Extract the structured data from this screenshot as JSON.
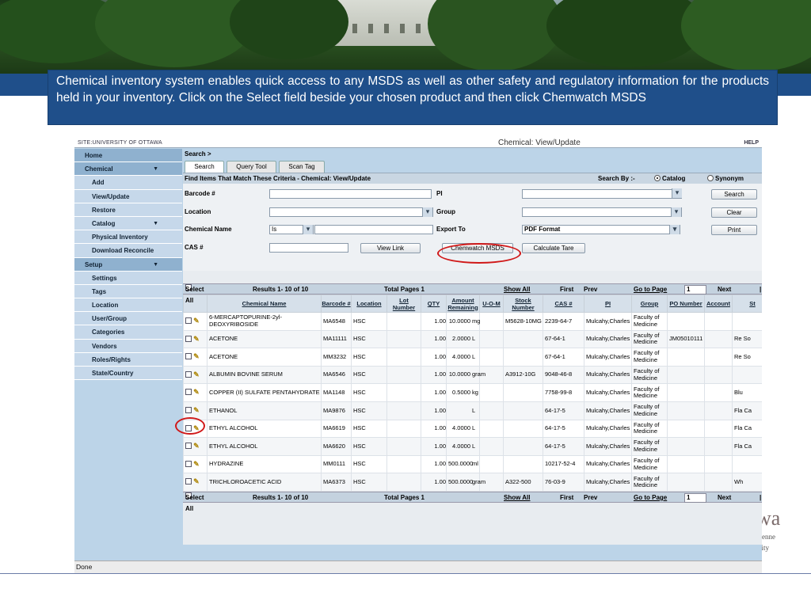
{
  "caption": "Chemical inventory system enables quick access to any MSDS as well as other safety and regulatory information for the products held in your inventory. Click on the Select field beside your chosen product and then click Chemwatch MSDS",
  "logo": {
    "text": "wa",
    "line1": "dienne",
    "line2": "rsity"
  },
  "app": {
    "site": "SITE:UNIVERSITY OF OTTAWA",
    "title": "Chemical: View/Update",
    "help": "HELP",
    "status": "Done"
  },
  "sidebar": {
    "items": [
      {
        "label": "Home",
        "level": 0
      },
      {
        "label": "Chemical",
        "level": 0,
        "arrow": "▼"
      },
      {
        "label": "Add",
        "level": 1
      },
      {
        "label": "View/Update",
        "level": 1
      },
      {
        "label": "Restore",
        "level": 1
      },
      {
        "label": "Catalog",
        "level": 1,
        "arrow": "▼"
      },
      {
        "label": "Physical Inventory",
        "level": 1
      },
      {
        "label": "Download Reconcile",
        "level": 1
      },
      {
        "label": "Setup",
        "level": 0,
        "arrow": "▼"
      },
      {
        "label": "Settings",
        "level": 1
      },
      {
        "label": "Tags",
        "level": 1
      },
      {
        "label": "Location",
        "level": 1
      },
      {
        "label": "User/Group",
        "level": 1
      },
      {
        "label": "Categories",
        "level": 1
      },
      {
        "label": "Vendors",
        "level": 1
      },
      {
        "label": "Roles/Rights",
        "level": 1
      },
      {
        "label": "State/Country",
        "level": 1
      }
    ]
  },
  "crumb": "Search >",
  "tabs": [
    "Search",
    "Query Tool",
    "Scan Tag"
  ],
  "find": {
    "title": "Find Items That Match These Criteria - Chemical: View/Update",
    "search_by": "Search By :-",
    "opt_catalog": "Catalog",
    "opt_synonym": "Synonym"
  },
  "form": {
    "barcode": "Barcode #",
    "pi": "PI",
    "location": "Location",
    "group": "Group",
    "chemical_name": "Chemical Name",
    "is": "Is",
    "export_to": "Export To",
    "export_value": "PDF Format",
    "cas": "CAS #",
    "search": "Search",
    "clear": "Clear",
    "print": "Print",
    "view_link": "View Link",
    "chemwatch": "Chemwatch MSDS",
    "calc_tare": "Calculate Tare"
  },
  "pager": {
    "select_all": "Select All",
    "results": "Results 1- 10 of 10",
    "total_pages": "Total Pages 1",
    "show_all": "Show All",
    "first": "First",
    "prev": "Prev",
    "goto": "Go to Page",
    "page": "1",
    "next": "Next"
  },
  "columns": [
    "",
    "Chemical Name",
    "Barcode #",
    "Location",
    "Lot Number",
    "QTY",
    "Amount Remaining",
    "U-O-M",
    "Stock Number",
    "CAS #",
    "PI",
    "Group",
    "PO Number",
    "Account",
    "St"
  ],
  "rows": [
    [
      "6-MERCAPTOPURINE-2yl-DEOXYRIBOSIDE",
      "MA6548",
      "HSC",
      "",
      "1.00",
      "10.0000",
      "mg",
      "M5628-10MG",
      "2239-64-7",
      "Mulcahy,Charles",
      "Faculty of Medicine",
      "",
      "",
      ""
    ],
    [
      "ACETONE",
      "MA11111",
      "HSC",
      "",
      "1.00",
      "2.0000",
      "L",
      "",
      "67-64-1",
      "Mulcahy,Charles",
      "Faculty of Medicine",
      "JM05010111",
      "",
      "Re So"
    ],
    [
      "ACETONE",
      "MM3232",
      "HSC",
      "",
      "1.00",
      "4.0000",
      "L",
      "",
      "67-64-1",
      "Mulcahy,Charles",
      "Faculty of Medicine",
      "",
      "",
      "Re So"
    ],
    [
      "ALBUMIN BOVINE SERUM",
      "MA6546",
      "HSC",
      "",
      "1.00",
      "10.0000",
      "gram",
      "A3912-10G",
      "9048-46-8",
      "Mulcahy,Charles",
      "Faculty of Medicine",
      "",
      "",
      ""
    ],
    [
      "COPPER (II) SULFATE PENTAHYDRATE",
      "MA1148",
      "HSC",
      "",
      "1.00",
      "0.5000",
      "kg",
      "",
      "7758-99-8",
      "Mulcahy,Charles",
      "Faculty of Medicine",
      "",
      "",
      "Blu"
    ],
    [
      "ETHANOL",
      "MA9876",
      "HSC",
      "",
      "1.00",
      "",
      "L",
      "",
      "64-17-5",
      "Mulcahy,Charles",
      "Faculty of Medicine",
      "",
      "",
      "Fla Ca"
    ],
    [
      "ETHYL ALCOHOL",
      "MA6619",
      "HSC",
      "",
      "1.00",
      "4.0000",
      "L",
      "",
      "64-17-5",
      "Mulcahy,Charles",
      "Faculty of Medicine",
      "",
      "",
      "Fla Ca"
    ],
    [
      "ETHYL ALCOHOL",
      "MA6620",
      "HSC",
      "",
      "1.00",
      "4.0000",
      "L",
      "",
      "64-17-5",
      "Mulcahy,Charles",
      "Faculty of Medicine",
      "",
      "",
      "Fla Ca"
    ],
    [
      "HYDRAZINE",
      "MM0111",
      "HSC",
      "",
      "1.00",
      "500.0000",
      "ml",
      "",
      "10217-52-4",
      "Mulcahy,Charles",
      "Faculty of Medicine",
      "",
      "",
      ""
    ],
    [
      "TRICHLOROACETIC ACID",
      "MA6373",
      "HSC",
      "",
      "1.00",
      "500.0000",
      "gram",
      "A322-500",
      "76-03-9",
      "Mulcahy,Charles",
      "Faculty of Medicine",
      "",
      "",
      "Wh"
    ]
  ]
}
